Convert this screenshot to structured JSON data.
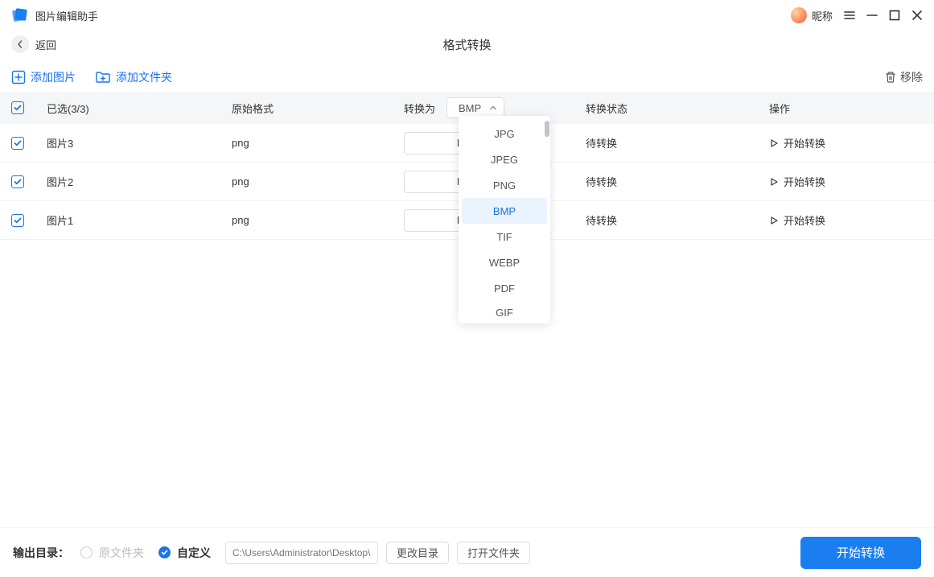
{
  "titlebar": {
    "app_title": "图片编辑助手",
    "nickname": "昵称"
  },
  "subheader": {
    "back_label": "返回",
    "page_title": "格式转换"
  },
  "toolbar": {
    "add_image": "添加图片",
    "add_folder": "添加文件夹",
    "remove": "移除"
  },
  "table": {
    "header": {
      "selected": "已选(3/3)",
      "orig_format": "原始格式",
      "convert_to": "转换为",
      "format_value": "BMP",
      "status": "转换状态",
      "action": "操作"
    },
    "rows": [
      {
        "name": "图片3",
        "orig": "png",
        "target": "BMP",
        "status": "待转换",
        "action": "开始转换"
      },
      {
        "name": "图片2",
        "orig": "png",
        "target": "BMP",
        "status": "待转换",
        "action": "开始转换"
      },
      {
        "name": "图片1",
        "orig": "png",
        "target": "BMP",
        "status": "待转换",
        "action": "开始转换"
      }
    ]
  },
  "dropdown": {
    "options": [
      "JPG",
      "JPEG",
      "PNG",
      "BMP",
      "TIF",
      "WEBP",
      "PDF",
      "GIF"
    ],
    "selected": "BMP"
  },
  "footer": {
    "output_label": "输出目录：",
    "radio_original": "原文件夹",
    "radio_custom": "自定义",
    "path_placeholder": "C:\\Users\\Administrator\\Desktop\\图",
    "change_dir": "更改目录",
    "open_folder": "打开文件夹",
    "start": "开始转换"
  }
}
